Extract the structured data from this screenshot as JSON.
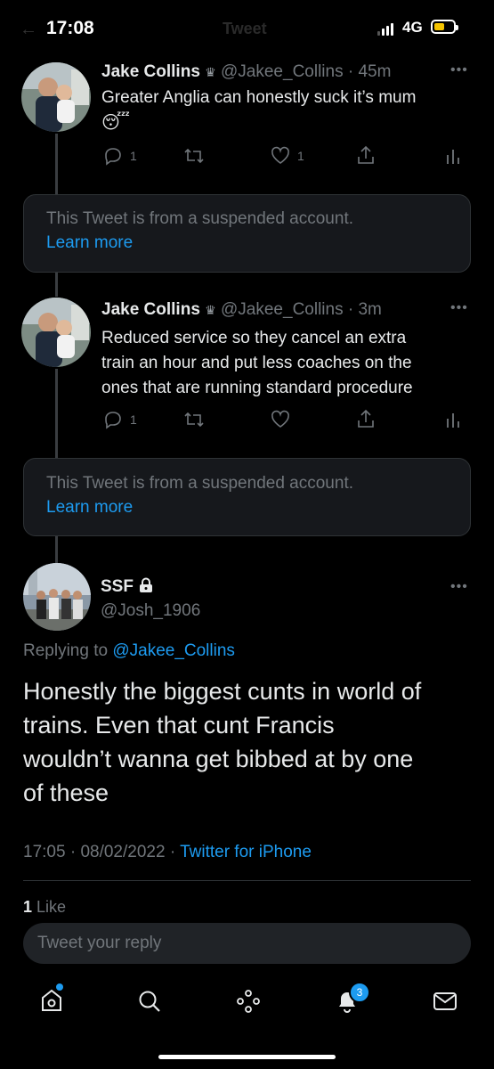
{
  "status_bar": {
    "time": "17:08",
    "network": "4G",
    "header_title": "Tweet"
  },
  "thread": [
    {
      "name": "Jake Collins",
      "handle": "@Jakee_Collins",
      "time": "45m",
      "text_line1": "Greater Anglia can honestly suck it’s mum",
      "emoji": "😴",
      "replies": "1",
      "retweets": "",
      "likes": "1"
    },
    {
      "suspended_text": "This Tweet is from a suspended account.",
      "learn_more": "Learn more"
    },
    {
      "name": "Jake Collins",
      "handle": "@Jakee_Collins",
      "time": "3m",
      "text_lines": [
        "Reduced service so they cancel an extra",
        "train an hour and put less coaches on the",
        "ones that are running standard procedure"
      ],
      "replies": "1",
      "retweets": "",
      "likes": ""
    },
    {
      "suspended_text": "This Tweet is from a suspended account.",
      "learn_more": "Learn more"
    }
  ],
  "main_tweet": {
    "name": "SSF",
    "handle": "@Josh_1906",
    "replying_prefix": "Replying to",
    "replying_to": "@Jakee_Collins",
    "text_lines": [
      "Honestly the biggest cunts in world of",
      "trains. Even that cunt Francis",
      "wouldn’t wanna get bibbed at by one",
      "of these"
    ],
    "time": "17:05",
    "date": "08/02/2022",
    "source": "Twitter for iPhone",
    "like_count": "1",
    "like_label": "Like"
  },
  "reply": {
    "placeholder": "Tweet your reply"
  },
  "bottom_nav": {
    "items": [
      "home-icon",
      "search-icon",
      "spaces-icon",
      "notifications-icon",
      "messages-icon"
    ],
    "notifications_badge": "3"
  },
  "colors": {
    "accent": "#1d9bf0",
    "muted": "#71767b",
    "background": "#000000"
  }
}
